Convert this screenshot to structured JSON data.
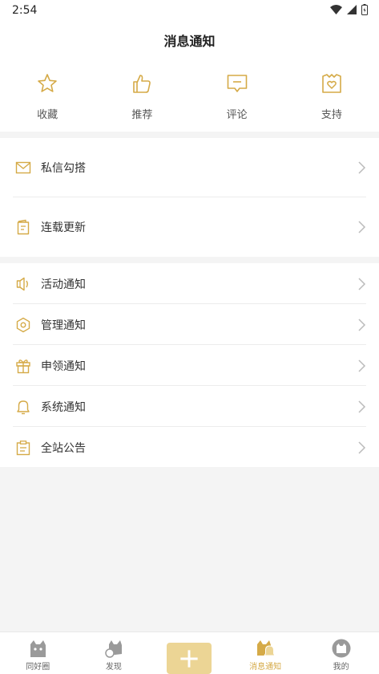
{
  "status_bar": {
    "time": "2:54"
  },
  "header": {
    "title": "消息通知"
  },
  "quick_actions": [
    {
      "label": "收藏",
      "icon": "star-icon"
    },
    {
      "label": "推荐",
      "icon": "thumbs-up-icon"
    },
    {
      "label": "评论",
      "icon": "comment-icon"
    },
    {
      "label": "支持",
      "icon": "gift-heart-icon"
    }
  ],
  "group1": [
    {
      "label": "私信勾搭",
      "icon": "mail-icon"
    },
    {
      "label": "连载更新",
      "icon": "book-icon"
    }
  ],
  "group2": [
    {
      "label": "活动通知",
      "icon": "speaker-icon"
    },
    {
      "label": "管理通知",
      "icon": "hexagon-icon"
    },
    {
      "label": "申领通知",
      "icon": "gift-icon"
    },
    {
      "label": "系统通知",
      "icon": "bell-icon"
    },
    {
      "label": "全站公告",
      "icon": "clipboard-icon"
    }
  ],
  "bottom_nav": [
    {
      "label": "同好圈",
      "icon": "cat-icon"
    },
    {
      "label": "发现",
      "icon": "cat-magnifier-icon"
    },
    {
      "label": "",
      "icon": "plus-icon"
    },
    {
      "label": "消息通知",
      "icon": "cat-bell-icon",
      "active": true
    },
    {
      "label": "我的",
      "icon": "cat-avatar-icon"
    }
  ],
  "colors": {
    "accent": "#d5aa47",
    "accent_light": "#ecd595",
    "background": "#f4f4f4"
  }
}
